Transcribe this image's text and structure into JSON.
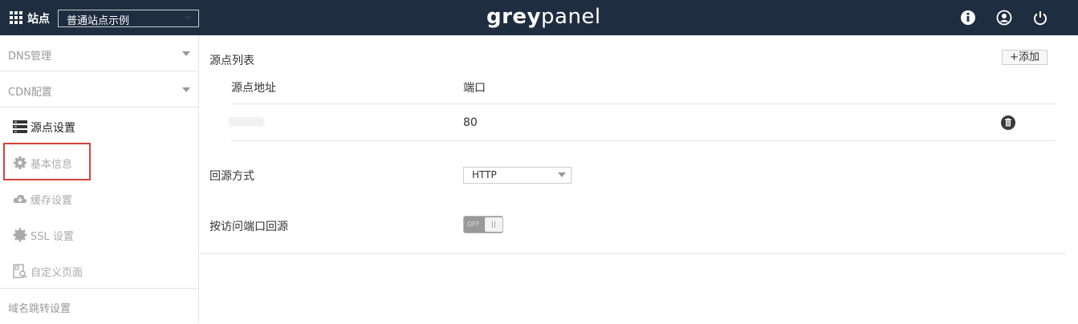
{
  "header": {
    "site_label": "站点",
    "site_select_value": "普通站点示例",
    "brand_grey": "grey",
    "brand_panel": "panel",
    "icons": [
      "grid-icon",
      "info-icon",
      "user-icon",
      "power-icon"
    ]
  },
  "sidebar": {
    "sections": [
      {
        "label": "DNS管理"
      },
      {
        "label": "CDN配置"
      }
    ],
    "items": [
      {
        "label": "源点设置",
        "icon": "server-icon",
        "active": true
      },
      {
        "label": "基本信息",
        "icon": "gear-icon"
      },
      {
        "label": "缓存设置",
        "icon": "cloud-download-icon"
      },
      {
        "label": "SSL 设置",
        "icon": "cog-icon"
      },
      {
        "label": "自定义页面",
        "icon": "page-search-icon"
      }
    ],
    "bottom_section": {
      "label": "域名跳转设置"
    }
  },
  "main": {
    "origin_list_title": "源点列表",
    "add_button": "+添加",
    "columns": [
      "源点地址",
      "端口"
    ],
    "rows": [
      {
        "address": "",
        "port": "80"
      }
    ],
    "back_to_origin": {
      "label": "回源方式",
      "value": "HTTP"
    },
    "port_follow": {
      "label": "按访问端口回源",
      "state": "OFF"
    }
  },
  "colors": {
    "topbar": "#1f2d40",
    "highlight": "#d9413a"
  }
}
